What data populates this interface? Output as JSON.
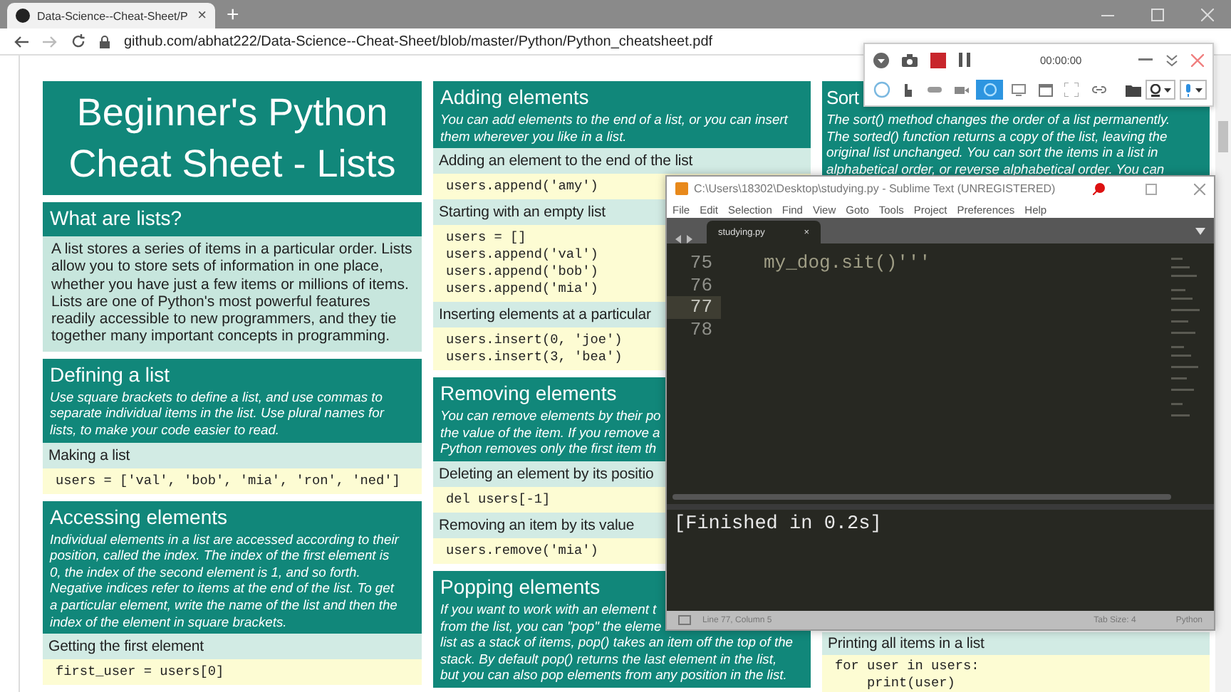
{
  "browser": {
    "tab": {
      "title": "Data-Science--Cheat-Sheet/P",
      "close": "×"
    },
    "new_tab": "+",
    "url": "github.com/abhat222/Data-Science--Cheat-Sheet/blob/master/Python/Python_cheatsheet.pdf"
  },
  "document": {
    "columns": [
      {
        "sections": [
          {
            "blocks": [
              {
                "kind": "title",
                "lines": [
                  "Beginner's Python",
                  "Cheat Sheet - Lists"
                ]
              }
            ]
          },
          {
            "blocks": [
              {
                "kind": "header",
                "title": "What are lists?"
              },
              {
                "kind": "body",
                "text": "A list stores a series of items in a particular order. Lists allow you to store sets of information in one place, whether you have just a few items or millions of items. Lists are one of Python's most powerful features readily accessible to new programmers, and they tie together many important concepts in programming."
              }
            ]
          },
          {
            "blocks": [
              {
                "kind": "header",
                "title": "Defining a list",
                "description": [
                  "Use square brackets to define a list, and use commas to",
                  "separate individual items in the list. Use plural names for",
                  "lists, to make your code easier to read."
                ]
              },
              {
                "kind": "label",
                "text": "Making a list"
              },
              {
                "kind": "code",
                "lines": [
                  "users = ['val', 'bob', 'mia', 'ron', 'ned']"
                ]
              }
            ]
          },
          {
            "blocks": [
              {
                "kind": "header",
                "title": "Accessing elements",
                "description": [
                  "Individual elements in a list are accessed according to their",
                  "position, called the index. The index of the first element is",
                  "0, the index of the second element is 1, and so forth.",
                  "Negative indices refer to items at the end of the list. To get",
                  "a particular element, write the name of the list and then the",
                  "index of the element in square brackets."
                ]
              },
              {
                "kind": "label",
                "text": "Getting the first element"
              },
              {
                "kind": "code",
                "lines": [
                  "first_user = users[0]"
                ]
              }
            ]
          }
        ]
      },
      {
        "sections": [
          {
            "blocks": [
              {
                "kind": "header",
                "title": "Adding elements",
                "description": [
                  "You can add elements to the end of a list, or you can insert",
                  "them wherever you like in a list."
                ]
              },
              {
                "kind": "label",
                "text": "Adding an element to the end of the list"
              },
              {
                "kind": "code",
                "lines": [
                  "users.append('amy')"
                ]
              },
              {
                "kind": "label",
                "text": "Starting with an empty list"
              },
              {
                "kind": "code",
                "lines": [
                  "users = []",
                  "users.append('val')",
                  "users.append('bob')",
                  "users.append('mia')"
                ]
              },
              {
                "kind": "label",
                "text": "Inserting elements at a particular"
              },
              {
                "kind": "code",
                "lines": [
                  "users.insert(0, 'joe')",
                  "users.insert(3, 'bea')"
                ]
              }
            ]
          },
          {
            "blocks": [
              {
                "kind": "header",
                "title": "Removing elements",
                "description": [
                  "You can remove elements by their po",
                  "the value of the item. If you remove a",
                  "Python removes only the first item th"
                ]
              },
              {
                "kind": "label",
                "text": "Deleting an element by its positio"
              },
              {
                "kind": "code",
                "lines": [
                  "del users[-1]"
                ]
              },
              {
                "kind": "label",
                "text": "Removing an item by its value"
              },
              {
                "kind": "code",
                "lines": [
                  "users.remove('mia')"
                ]
              }
            ]
          },
          {
            "blocks": [
              {
                "kind": "header",
                "title": "Popping elements",
                "description": [
                  "If you want to work with an element t",
                  "from the list, you can \"pop\" the eleme",
                  "list as a stack of items, pop() takes an item off the top of the",
                  "stack. By default pop() returns the last element in the list,",
                  "but you can also pop elements from any position in the list."
                ]
              }
            ]
          }
        ]
      },
      {
        "sections": [
          {
            "blocks": [
              {
                "kind": "header",
                "title": "Sort",
                "description": [
                  "The sort() method changes the order of a list permanently.",
                  "The sorted() function returns a copy of the list, leaving the",
                  "original list unchanged. You can sort the items in a list in",
                  "alphabetical order, or reverse alphabetical order. You can"
                ]
              }
            ]
          },
          {
            "blocks": [
              {
                "kind": "label",
                "text": "Printing all items in a list"
              },
              {
                "kind": "code",
                "lines": [
                  "for user in users:",
                  "    print(user)"
                ]
              }
            ]
          }
        ]
      }
    ]
  },
  "editor": {
    "title": "C:\\Users\\18302\\Desktop\\studying.py - Sublime Text (UNREGISTERED)",
    "menu": [
      "File",
      "Edit",
      "Selection",
      "Find",
      "View",
      "Goto",
      "Tools",
      "Project",
      "Preferences",
      "Help"
    ],
    "tab": {
      "title": "studying.py",
      "close": "×"
    },
    "lines": [
      {
        "number": "75",
        "text": "my_dog.sit()'''",
        "selected": false
      },
      {
        "number": "76",
        "selected": false
      },
      {
        "number": "77",
        "selected": true
      },
      {
        "number": "78",
        "selected": false
      }
    ],
    "output": "[Finished in 0.2s]",
    "status": {
      "position": "Line 77, Column 5",
      "tab_size": "Tab Size: 4",
      "syntax": "Python"
    }
  },
  "recorder": {
    "timer": "00:00:00",
    "modes": [
      {
        "selected": false
      },
      {
        "selected": false
      },
      {
        "selected": false
      },
      {
        "selected": false
      },
      {
        "selected": true
      },
      {
        "selected": false
      },
      {
        "selected": false
      },
      {
        "selected": false
      },
      {
        "selected": false
      }
    ]
  }
}
